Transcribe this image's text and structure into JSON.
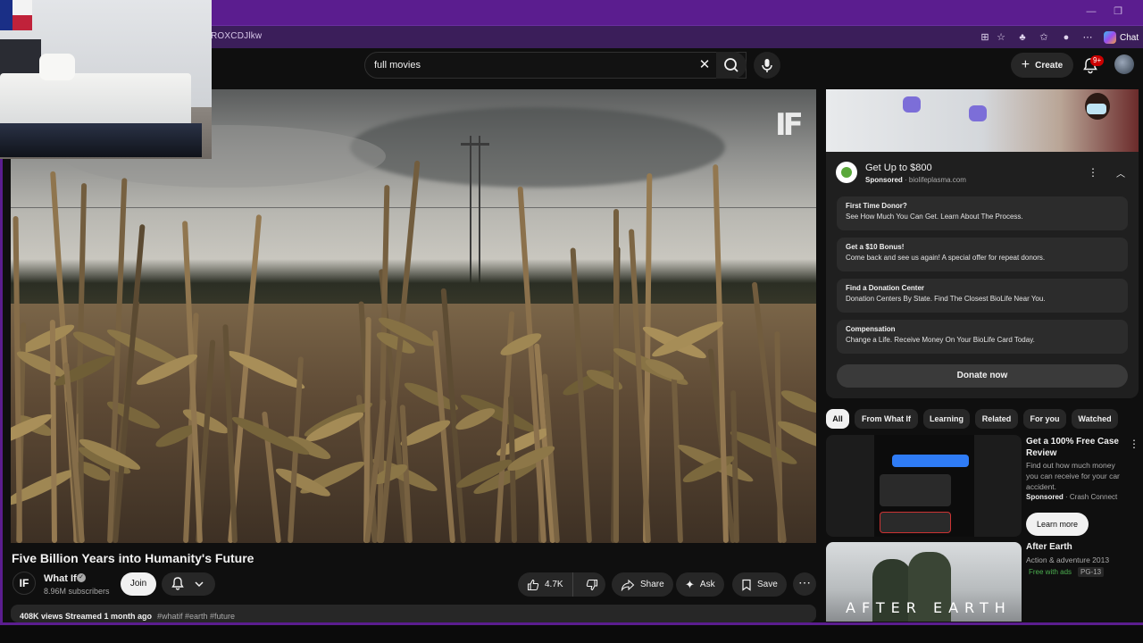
{
  "browser": {
    "url_fragment": "ROXCDJlkw",
    "chat_label": "Chat"
  },
  "header": {
    "search_value": "full movies",
    "create_label": "Create",
    "notification_count": "9+"
  },
  "video": {
    "title": "Five Billion Years into Humanity's Future",
    "watermark": "IF",
    "channel": {
      "avatar_text": "IF",
      "name": "What If",
      "subscribers": "8.96M subscribers",
      "join_label": "Join"
    },
    "actions": {
      "likes": "4.7K",
      "share_label": "Share",
      "ask_label": "Ask",
      "save_label": "Save"
    },
    "description": {
      "views": "408K views  Streamed 1 month ago",
      "tags": "#whatif #earth #future"
    }
  },
  "ad": {
    "title": "Get Up to $800",
    "sponsored_label": "Sponsored",
    "domain": "biolifeplasma.com",
    "cards": [
      {
        "title": "First Time Donor?",
        "desc": "See How Much You Can Get. Learn About The Process."
      },
      {
        "title": "Get a $10 Bonus!",
        "desc": "Come back and see us again! A special offer for repeat donors."
      },
      {
        "title": "Find a Donation Center",
        "desc": "Donation Centers By State. Find The Closest BioLife Near You."
      },
      {
        "title": "Compensation",
        "desc": "Change a Life. Receive Money On Your BioLife Card Today."
      }
    ],
    "cta_label": "Donate now"
  },
  "chips": [
    "All",
    "From What If",
    "Learning",
    "Related",
    "For you",
    "Watched"
  ],
  "recommendations": [
    {
      "title": "Get a 100% Free Case Review",
      "desc": "Find out how much money you can receive for your car accident.",
      "sponsored_label": "Sponsored",
      "advertiser": "Crash Connect",
      "cta_label": "Learn more"
    },
    {
      "title": "After Earth",
      "meta": "Action & adventure 2013",
      "free_label": "Free with ads",
      "rating": "PG-13",
      "thumb_text": "AFTER EARTH"
    }
  ],
  "colors": {
    "browser_accent": "#5b1d8f",
    "background": "#0f0f0f",
    "notification_badge": "#cc0000",
    "free_with_ads": "#4caf50"
  }
}
